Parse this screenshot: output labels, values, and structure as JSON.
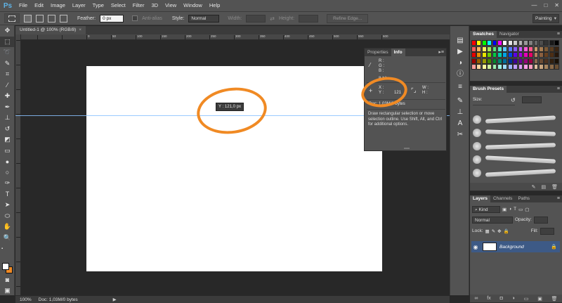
{
  "app": {
    "logo": "Ps",
    "menu": [
      "File",
      "Edit",
      "Image",
      "Layer",
      "Type",
      "Select",
      "Filter",
      "3D",
      "View",
      "Window",
      "Help"
    ],
    "window_controls": [
      "—",
      "□",
      "✕"
    ]
  },
  "options_bar": {
    "feather_label": "Feather:",
    "feather_value": "0 px",
    "anti_alias_label": "Anti-alias",
    "style_label": "Style:",
    "style_value": "Normal",
    "width_label": "Width:",
    "height_label": "Height:",
    "refine_edge_label": "Refine Edge...",
    "workspace_value": "Painting"
  },
  "document": {
    "tab_title": "Untitled-1 @ 100% (RGB/8)",
    "tooltip": "Y : 121,0 px",
    "ruler_labels": [
      "0",
      "50",
      "100",
      "150",
      "200",
      "250",
      "300",
      "350",
      "400",
      "450",
      "500",
      "550",
      "600"
    ]
  },
  "info_panel": {
    "tabs": [
      "Properties",
      "Info"
    ],
    "r_label": "R :",
    "g_label": "G :",
    "b_label": "B :",
    "bit_depth": "8-bit",
    "x_label": "X :",
    "y_label": "Y :",
    "y_value": "121",
    "w_label": "W :",
    "h_label": "H :",
    "doc_size": "Doc: 1,03M/0 bytes",
    "description": "Draw rectangular selection or move selection outline.  Use Shift, Alt, and Ctrl for additional options."
  },
  "swatches_panel": {
    "tabs": [
      "Swatches",
      "Navigator"
    ],
    "colors": [
      "#ff0000",
      "#ffff00",
      "#00ff00",
      "#00ffff",
      "#0000ff",
      "#ff00ff",
      "#ffffff",
      "#e6e6e6",
      "#cccccc",
      "#b3b3b3",
      "#999999",
      "#808080",
      "#666666",
      "#4d4d4d",
      "#333333",
      "#1a1a1a",
      "#000000",
      "#ff5b5b",
      "#ffb35b",
      "#fff35b",
      "#a8e65b",
      "#5be67a",
      "#5be6c8",
      "#5bc8ff",
      "#5b7aff",
      "#8a5bff",
      "#c85bff",
      "#ff5bd7",
      "#ff5b8a",
      "#c79a6b",
      "#a57c52",
      "#7d5a36",
      "#5a3d20",
      "#3b2410",
      "#e60000",
      "#e68a00",
      "#e6e600",
      "#6bcc00",
      "#00cc44",
      "#00ccaa",
      "#00a3e6",
      "#0044e6",
      "#5c00e6",
      "#a300e6",
      "#e600b8",
      "#e60066",
      "#b38060",
      "#8c6040",
      "#664020",
      "#4d2e14",
      "#26160a",
      "#990000",
      "#995c00",
      "#999900",
      "#478800",
      "#00882d",
      "#008871",
      "#006b99",
      "#002d99",
      "#3d0099",
      "#6b0099",
      "#99007a",
      "#990044",
      "#8c6a50",
      "#6b4c34",
      "#4d3320",
      "#33200f",
      "#1a1005",
      "#ff9e9e",
      "#ffd49e",
      "#fffa9e",
      "#d1f29e",
      "#9ef2b3",
      "#9ef2e0",
      "#9edcff",
      "#9eb3ff",
      "#bf9eff",
      "#e09eff",
      "#ff9eea",
      "#ff9ebf",
      "#e0c0a0",
      "#c9a680",
      "#a88660",
      "#8a6a48",
      "#6b5034"
    ]
  },
  "brush_presets": {
    "title": "Brush Presets",
    "size_label": "Size:"
  },
  "layers_panel": {
    "tabs": [
      "Layers",
      "Channels",
      "Paths"
    ],
    "kind_label": "Kind",
    "blend_mode": "Normal",
    "opacity_label": "Opacity:",
    "lock_label": "Lock:",
    "fill_label": "Fill:",
    "layer_name": "Background",
    "footer_icons": [
      "link-icon",
      "fx-icon",
      "mask-icon",
      "adjustment-icon",
      "folder-icon",
      "new-layer-icon",
      "trash-icon"
    ]
  },
  "status_bar": {
    "zoom": "100%",
    "doc_info": "Doc: 1,03M/0 bytes",
    "arrow": "▶"
  },
  "colors": {
    "foreground": "#ffffff",
    "background": "#f08a24",
    "annotation": "#f08a24",
    "guide": "#8ac1ff",
    "selected_layer": "#3d5a86"
  }
}
